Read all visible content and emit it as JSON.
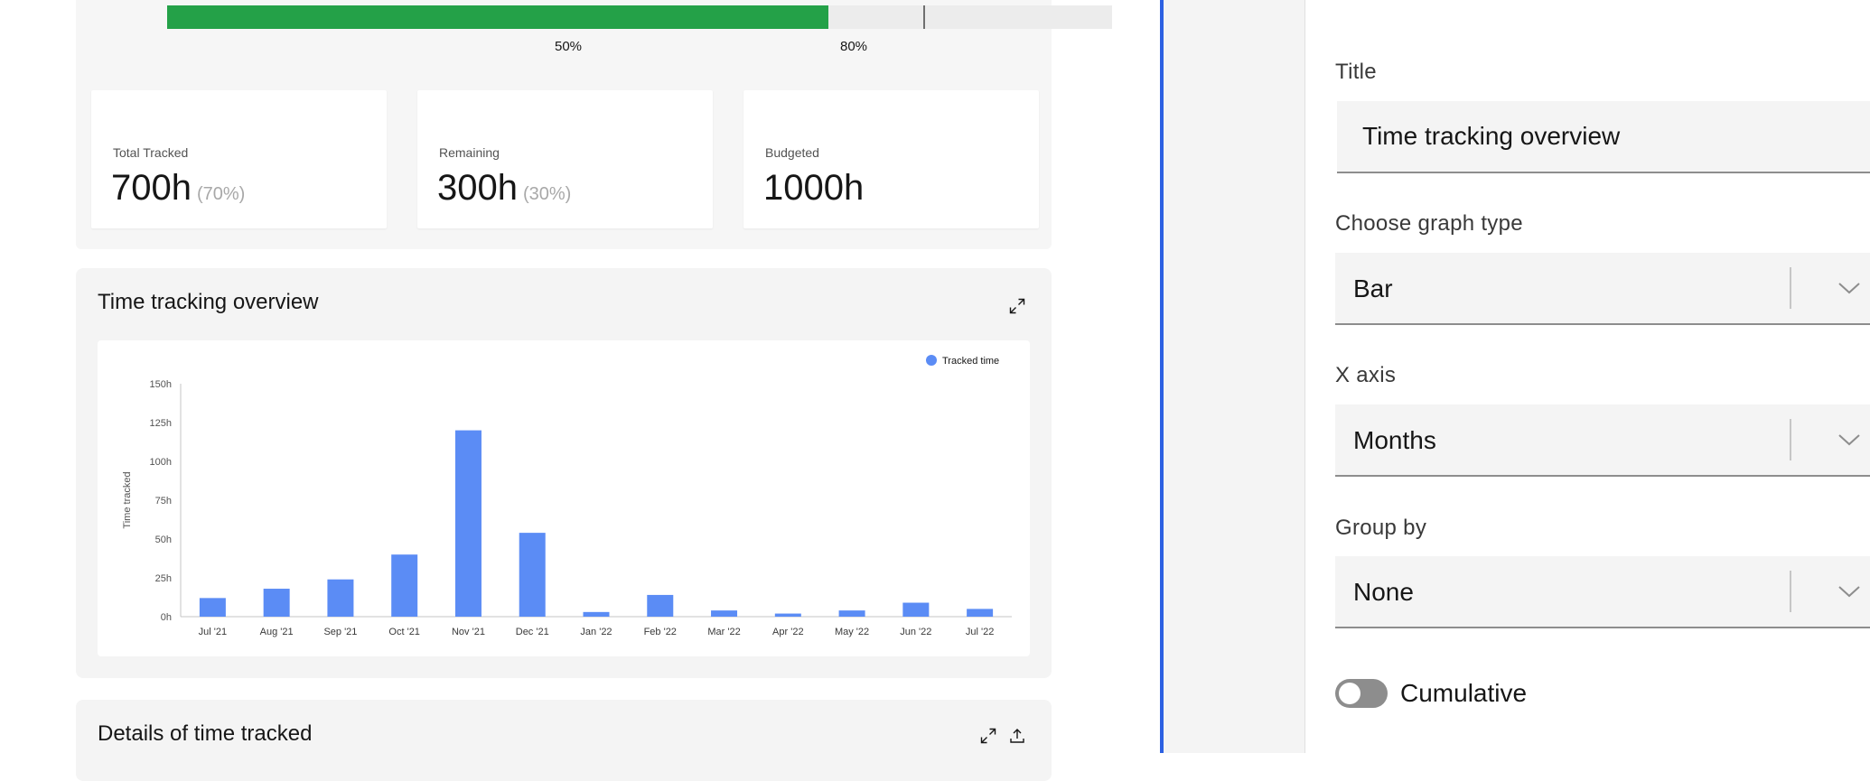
{
  "budget": {
    "progress_percent": 70,
    "target_marker_percent": 80,
    "tick_labels": [
      "50%",
      "80%"
    ]
  },
  "stats": [
    {
      "label": "Total Tracked",
      "value": "700h",
      "pct": "(70%)"
    },
    {
      "label": "Remaining",
      "value": "300h",
      "pct": "(30%)"
    },
    {
      "label": "Budgeted",
      "value": "1000h",
      "pct": ""
    }
  ],
  "overview": {
    "title": "Time tracking overview",
    "expand_icon": "maximize-icon"
  },
  "chart_data": {
    "type": "bar",
    "categories": [
      "Jul '21",
      "Aug '21",
      "Sep '21",
      "Oct '21",
      "Nov '21",
      "Dec '21",
      "Jan '22",
      "Feb '22",
      "Mar '22",
      "Apr '22",
      "May '22",
      "Jun '22",
      "Jul '22"
    ],
    "series": [
      {
        "name": "Tracked time",
        "values": [
          12,
          18,
          24,
          40,
          120,
          54,
          3,
          14,
          4,
          2,
          4,
          9,
          5
        ],
        "color": "#5b8cf5"
      }
    ],
    "ylabel": "Time tracked",
    "xlabel": "",
    "ylim": [
      0,
      150
    ],
    "yticks": [
      "0h",
      "25h",
      "50h",
      "75h",
      "100h",
      "125h",
      "150h"
    ],
    "legend_position": "top-right",
    "grid": false
  },
  "details": {
    "title": "Details of time tracked",
    "expand_icon": "maximize-icon",
    "export_icon": "upload-icon"
  },
  "settings": {
    "title_label": "Title",
    "title_value": "Time tracking overview",
    "graph_type_label": "Choose graph type",
    "graph_type_value": "Bar",
    "x_axis_label": "X axis",
    "x_axis_value": "Months",
    "group_by_label": "Group by",
    "group_by_value": "None",
    "cumulative_label": "Cumulative",
    "cumulative_on": false
  },
  "colors": {
    "progress": "#24a148",
    "accent_divider": "#2d61e2",
    "bar": "#5b8cf5"
  }
}
